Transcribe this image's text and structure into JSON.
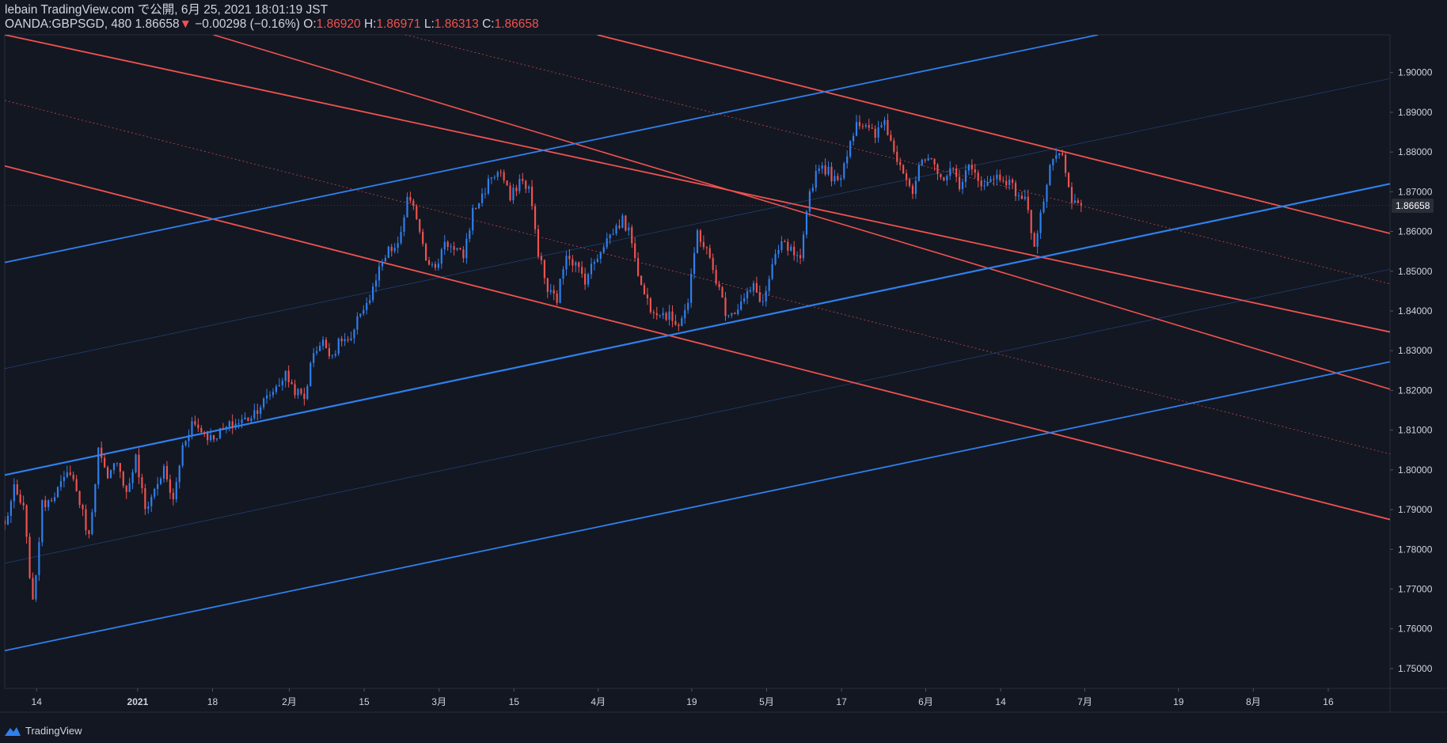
{
  "header": {
    "line1": "lebain TradingView.com で公開, 6月 25, 2021 18:01:19 JST",
    "symbol": "OANDA:GBPSGD, 480",
    "last": "1.86658",
    "change_arrow": "▼",
    "change": "−0.00298 (−0.16%)",
    "o_label": "O:",
    "o_value": "1.86920",
    "h_label": "H:",
    "h_value": "1.86971",
    "l_label": "L:",
    "l_value": "1.86313",
    "c_label": "C:",
    "c_value": "1.86658"
  },
  "footer": {
    "brand": "TradingView",
    "icon": "tradingview-logo-icon"
  },
  "colors": {
    "background": "#131722",
    "up": "#2f80ed",
    "down": "#ef5350",
    "grid": "#1e222d"
  },
  "chart_data": {
    "type": "candlestick",
    "symbol": "OANDA:GBPSGD",
    "interval": "480",
    "ylim": [
      1.745,
      1.9095
    ],
    "y_ticks": [
      "1.90000",
      "1.89000",
      "1.88000",
      "1.87000",
      "1.86000",
      "1.85000",
      "1.84000",
      "1.83000",
      "1.82000",
      "1.81000",
      "1.80000",
      "1.79000",
      "1.78000",
      "1.77000",
      "1.76000",
      "1.75000"
    ],
    "y_tick_values": [
      1.9,
      1.89,
      1.88,
      1.87,
      1.86,
      1.85,
      1.84,
      1.83,
      1.82,
      1.81,
      1.8,
      1.79,
      1.78,
      1.77,
      1.76,
      1.75
    ],
    "x_domain": [
      0,
      148
    ],
    "x_ticks": [
      {
        "label": "14",
        "t": 3.4
      },
      {
        "label": "2021",
        "t": 14.2
      },
      {
        "label": "18",
        "t": 22.2
      },
      {
        "label": "2月",
        "t": 30.4
      },
      {
        "label": "15",
        "t": 38.4
      },
      {
        "label": "3月",
        "t": 46.4
      },
      {
        "label": "15",
        "t": 54.4
      },
      {
        "label": "4月",
        "t": 63.4
      },
      {
        "label": "19",
        "t": 73.4
      },
      {
        "label": "5月",
        "t": 81.4
      },
      {
        "label": "17",
        "t": 89.4
      },
      {
        "label": "6月",
        "t": 98.4
      },
      {
        "label": "14",
        "t": 106.4
      },
      {
        "label": "7月",
        "t": 115.4
      },
      {
        "label": "19",
        "t": 125.4
      },
      {
        "label": "8月",
        "t": 133.4
      },
      {
        "label": "16",
        "t": 141.4
      }
    ],
    "last_price": 1.86658,
    "last_price_label": "1.86658",
    "anchors": [
      [
        0,
        1.786
      ],
      [
        1,
        1.795
      ],
      [
        2,
        1.79
      ],
      [
        3,
        1.766
      ],
      [
        4,
        1.791
      ],
      [
        6,
        1.796
      ],
      [
        7,
        1.8
      ],
      [
        8,
        1.792
      ],
      [
        9,
        1.783
      ],
      [
        10,
        1.805
      ],
      [
        11,
        1.797
      ],
      [
        12,
        1.803
      ],
      [
        13,
        1.794
      ],
      [
        14,
        1.803
      ],
      [
        15,
        1.79
      ],
      [
        16,
        1.795
      ],
      [
        17,
        1.8
      ],
      [
        18,
        1.792
      ],
      [
        19,
        1.806
      ],
      [
        20,
        1.812
      ],
      [
        22,
        1.808
      ],
      [
        24,
        1.811
      ],
      [
        26,
        1.813
      ],
      [
        28,
        1.818
      ],
      [
        30,
        1.824
      ],
      [
        31,
        1.82
      ],
      [
        32,
        1.818
      ],
      [
        33,
        1.83
      ],
      [
        34,
        1.832
      ],
      [
        35,
        1.829
      ],
      [
        36,
        1.833
      ],
      [
        37,
        1.832
      ],
      [
        38,
        1.84
      ],
      [
        39,
        1.843
      ],
      [
        40,
        1.85
      ],
      [
        41,
        1.855
      ],
      [
        42,
        1.856
      ],
      [
        43,
        1.868
      ],
      [
        44,
        1.864
      ],
      [
        45,
        1.854
      ],
      [
        46,
        1.85
      ],
      [
        47,
        1.858
      ],
      [
        48,
        1.855
      ],
      [
        49,
        1.854
      ],
      [
        50,
        1.865
      ],
      [
        51,
        1.869
      ],
      [
        52,
        1.874
      ],
      [
        53,
        1.875
      ],
      [
        54,
        1.868
      ],
      [
        55,
        1.873
      ],
      [
        56,
        1.871
      ],
      [
        57,
        1.855
      ],
      [
        58,
        1.845
      ],
      [
        59,
        1.843
      ],
      [
        60,
        1.855
      ],
      [
        62,
        1.848
      ],
      [
        64,
        1.857
      ],
      [
        66,
        1.863
      ],
      [
        67,
        1.858
      ],
      [
        68,
        1.846
      ],
      [
        69,
        1.841
      ],
      [
        70,
        1.84
      ],
      [
        72,
        1.837
      ],
      [
        73,
        1.842
      ],
      [
        74,
        1.86
      ],
      [
        75,
        1.855
      ],
      [
        76,
        1.848
      ],
      [
        77,
        1.84
      ],
      [
        78,
        1.84
      ],
      [
        80,
        1.846
      ],
      [
        81,
        1.842
      ],
      [
        82,
        1.851
      ],
      [
        83,
        1.857
      ],
      [
        84,
        1.855
      ],
      [
        85,
        1.852
      ],
      [
        86,
        1.87
      ],
      [
        87,
        1.877
      ],
      [
        88,
        1.875
      ],
      [
        89,
        1.872
      ],
      [
        90,
        1.88
      ],
      [
        91,
        1.888
      ],
      [
        92,
        1.886
      ],
      [
        93,
        1.884
      ],
      [
        94,
        1.888
      ],
      [
        95,
        1.88
      ],
      [
        96,
        1.876
      ],
      [
        97,
        1.87
      ],
      [
        98,
        1.878
      ],
      [
        99,
        1.877
      ],
      [
        100,
        1.873
      ],
      [
        101,
        1.876
      ],
      [
        102,
        1.872
      ],
      [
        103,
        1.876
      ],
      [
        104,
        1.873
      ],
      [
        105,
        1.872
      ],
      [
        106,
        1.874
      ],
      [
        107,
        1.873
      ],
      [
        108,
        1.87
      ],
      [
        109,
        1.868
      ],
      [
        110,
        1.857
      ],
      [
        111,
        1.868
      ],
      [
        112,
        1.879
      ],
      [
        113,
        1.878
      ],
      [
        114,
        1.867
      ],
      [
        115,
        1.8666
      ]
    ],
    "trend_lines": [
      {
        "color": "#ef5350",
        "width": 1.8,
        "points": [
          [
            0,
            1.9095
          ],
          [
            148,
            1.8347
          ]
        ]
      },
      {
        "color": "#ef5350",
        "width": 1.8,
        "points": [
          [
            0,
            1.8765
          ],
          [
            148,
            1.7875
          ]
        ]
      },
      {
        "color": "#ef5350",
        "width": 1.8,
        "points": [
          [
            63.3,
            1.9095
          ],
          [
            148,
            1.8595
          ]
        ]
      },
      {
        "color": "#ef5350",
        "width": 1.6,
        "points": [
          [
            22.3,
            1.9095
          ],
          [
            148,
            1.8203
          ]
        ]
      },
      {
        "color": "#ef5350",
        "width": 0.8,
        "dash": "2,3",
        "opacity": 0.8,
        "points": [
          [
            0,
            1.893
          ],
          [
            148,
            1.804
          ]
        ]
      },
      {
        "color": "#ef5350",
        "width": 0.8,
        "dash": "2,3",
        "opacity": 0.8,
        "points": [
          [
            42.8,
            1.9095
          ],
          [
            148,
            1.8468
          ]
        ]
      },
      {
        "color": "#2f80ed",
        "width": 2.2,
        "points": [
          [
            0,
            1.7987
          ],
          [
            148,
            1.872
          ]
        ]
      },
      {
        "color": "#2f80ed",
        "width": 1.8,
        "points": [
          [
            0,
            1.8522
          ],
          [
            116.8,
            1.9095
          ]
        ]
      },
      {
        "color": "#2f80ed",
        "width": 1.8,
        "points": [
          [
            0,
            1.7545
          ],
          [
            148,
            1.8272
          ]
        ]
      },
      {
        "color": "#2f80ed",
        "width": 0.6,
        "opacity": 0.5,
        "points": [
          [
            0,
            1.8255
          ],
          [
            148,
            1.8985
          ]
        ]
      },
      {
        "color": "#2f80ed",
        "width": 0.6,
        "opacity": 0.5,
        "points": [
          [
            0,
            1.7765
          ],
          [
            148,
            1.8505
          ]
        ]
      }
    ]
  }
}
